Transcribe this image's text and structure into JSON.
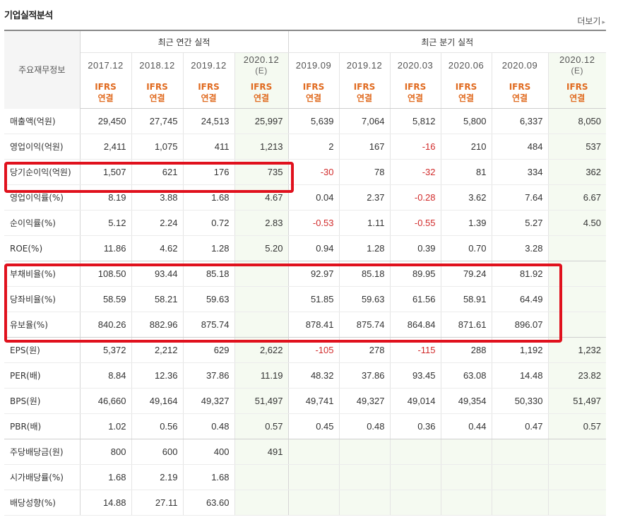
{
  "page": {
    "title": "기업실적분석",
    "more_label": "더보기"
  },
  "table": {
    "row_header": "주요재무정보",
    "groups": [
      "최근 연간 실적",
      "최근 분기 실적"
    ],
    "periods": [
      "2017.12",
      "2018.12",
      "2019.12",
      "2020.12",
      "2019.09",
      "2019.12",
      "2020.03",
      "2020.06",
      "2020.09",
      "2020.12"
    ],
    "estimate_marks": [
      "(E)",
      "(E)"
    ],
    "ifrs_top": "IFRS",
    "ifrs_bottom": "연결",
    "rows": [
      {
        "label": "매출액(억원)",
        "values": [
          "29,450",
          "27,745",
          "24,513",
          "25,997",
          "5,639",
          "7,064",
          "5,812",
          "5,800",
          "6,337",
          "8,050"
        ]
      },
      {
        "label": "영업이익(억원)",
        "values": [
          "2,411",
          "1,075",
          "411",
          "1,213",
          "2",
          "167",
          "-16",
          "210",
          "484",
          "537"
        ]
      },
      {
        "label": "당기순이익(억원)",
        "values": [
          "1,507",
          "621",
          "176",
          "735",
          "-30",
          "78",
          "-32",
          "81",
          "334",
          "362"
        ]
      },
      {
        "label": "영업이익률(%)",
        "values": [
          "8.19",
          "3.88",
          "1.68",
          "4.67",
          "0.04",
          "2.37",
          "-0.28",
          "3.62",
          "7.64",
          "6.67"
        ]
      },
      {
        "label": "순이익률(%)",
        "values": [
          "5.12",
          "2.24",
          "0.72",
          "2.83",
          "-0.53",
          "1.11",
          "-0.55",
          "1.39",
          "5.27",
          "4.50"
        ]
      },
      {
        "label": "ROE(%)",
        "values": [
          "11.86",
          "4.62",
          "1.28",
          "5.20",
          "0.94",
          "1.28",
          "0.39",
          "0.70",
          "3.28",
          ""
        ]
      },
      {
        "label": "부채비율(%)",
        "values": [
          "108.50",
          "93.44",
          "85.18",
          "",
          "92.97",
          "85.18",
          "89.95",
          "79.24",
          "81.92",
          ""
        ]
      },
      {
        "label": "당좌비율(%)",
        "values": [
          "58.59",
          "58.21",
          "59.63",
          "",
          "51.85",
          "59.63",
          "61.56",
          "58.91",
          "64.49",
          ""
        ]
      },
      {
        "label": "유보율(%)",
        "values": [
          "840.26",
          "882.96",
          "875.74",
          "",
          "878.41",
          "875.74",
          "864.84",
          "871.61",
          "896.07",
          ""
        ]
      },
      {
        "label": "EPS(원)",
        "values": [
          "5,372",
          "2,212",
          "629",
          "2,622",
          "-105",
          "278",
          "-115",
          "288",
          "1,192",
          "1,232"
        ]
      },
      {
        "label": "PER(배)",
        "values": [
          "8.84",
          "12.36",
          "37.86",
          "11.19",
          "48.32",
          "37.86",
          "93.45",
          "63.08",
          "14.48",
          "23.82"
        ]
      },
      {
        "label": "BPS(원)",
        "values": [
          "46,660",
          "49,164",
          "49,327",
          "51,497",
          "49,741",
          "49,327",
          "49,014",
          "49,354",
          "50,330",
          "51,497"
        ]
      },
      {
        "label": "PBR(배)",
        "values": [
          "1.02",
          "0.56",
          "0.48",
          "0.57",
          "0.45",
          "0.48",
          "0.36",
          "0.44",
          "0.47",
          "0.57"
        ]
      },
      {
        "label": "주당배당금(원)",
        "values": [
          "800",
          "600",
          "400",
          "491",
          "",
          "",
          "",
          "",
          "",
          ""
        ]
      },
      {
        "label": "시가배당률(%)",
        "values": [
          "1.68",
          "2.19",
          "1.68",
          "",
          "",
          "",
          "",
          "",
          "",
          ""
        ]
      },
      {
        "label": "배당성향(%)",
        "values": [
          "14.88",
          "27.11",
          "63.60",
          "",
          "",
          "",
          "",
          "",
          "",
          ""
        ]
      }
    ]
  },
  "colors": {
    "ifrs": "#e06a1f",
    "negative": "#d12b2b",
    "estimate_bg": "#f5faf1",
    "highlight": "#e0111d"
  }
}
